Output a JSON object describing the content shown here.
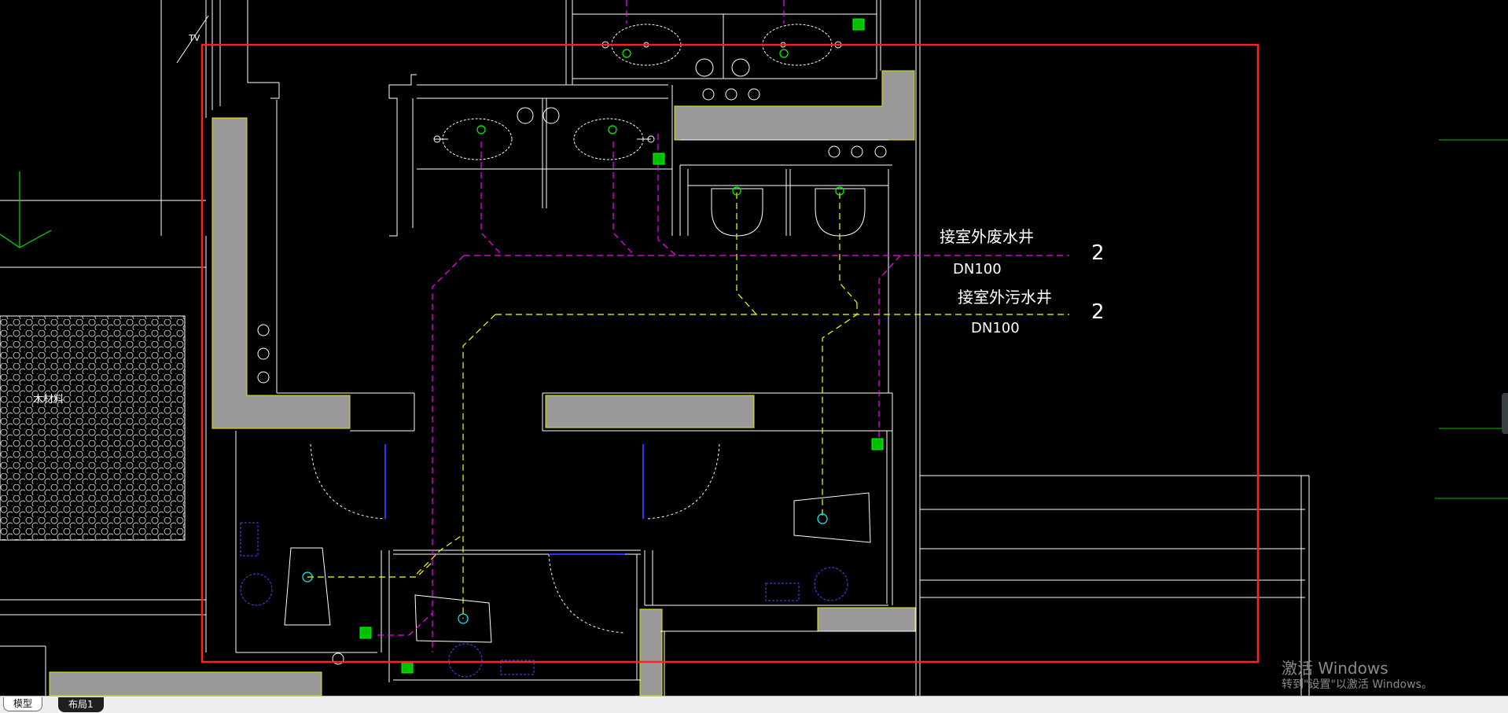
{
  "drawing": {
    "annotations": [
      {
        "title": "接室外废水井",
        "size": "DN100",
        "marker": "2"
      },
      {
        "title": "接室外污水井",
        "size": "DN100",
        "marker": "2"
      }
    ],
    "area_label": "木材料",
    "tv_label": "TV"
  },
  "tabs": [
    {
      "label": "模型"
    },
    {
      "label": "布局1"
    }
  ],
  "watermark": {
    "title": "激活 Windows",
    "subtitle": "转到\"设置\"以激活 Windows。"
  },
  "colors": {
    "background": "#000000",
    "wall": "#ffffff",
    "wall_fill": "#999999",
    "highlight_outline": "#ff0000",
    "waste_pipe": "#ff00ff",
    "sewage_pipe": "#ffff00",
    "fixture": "#00ff00",
    "door": "#0000ff"
  }
}
